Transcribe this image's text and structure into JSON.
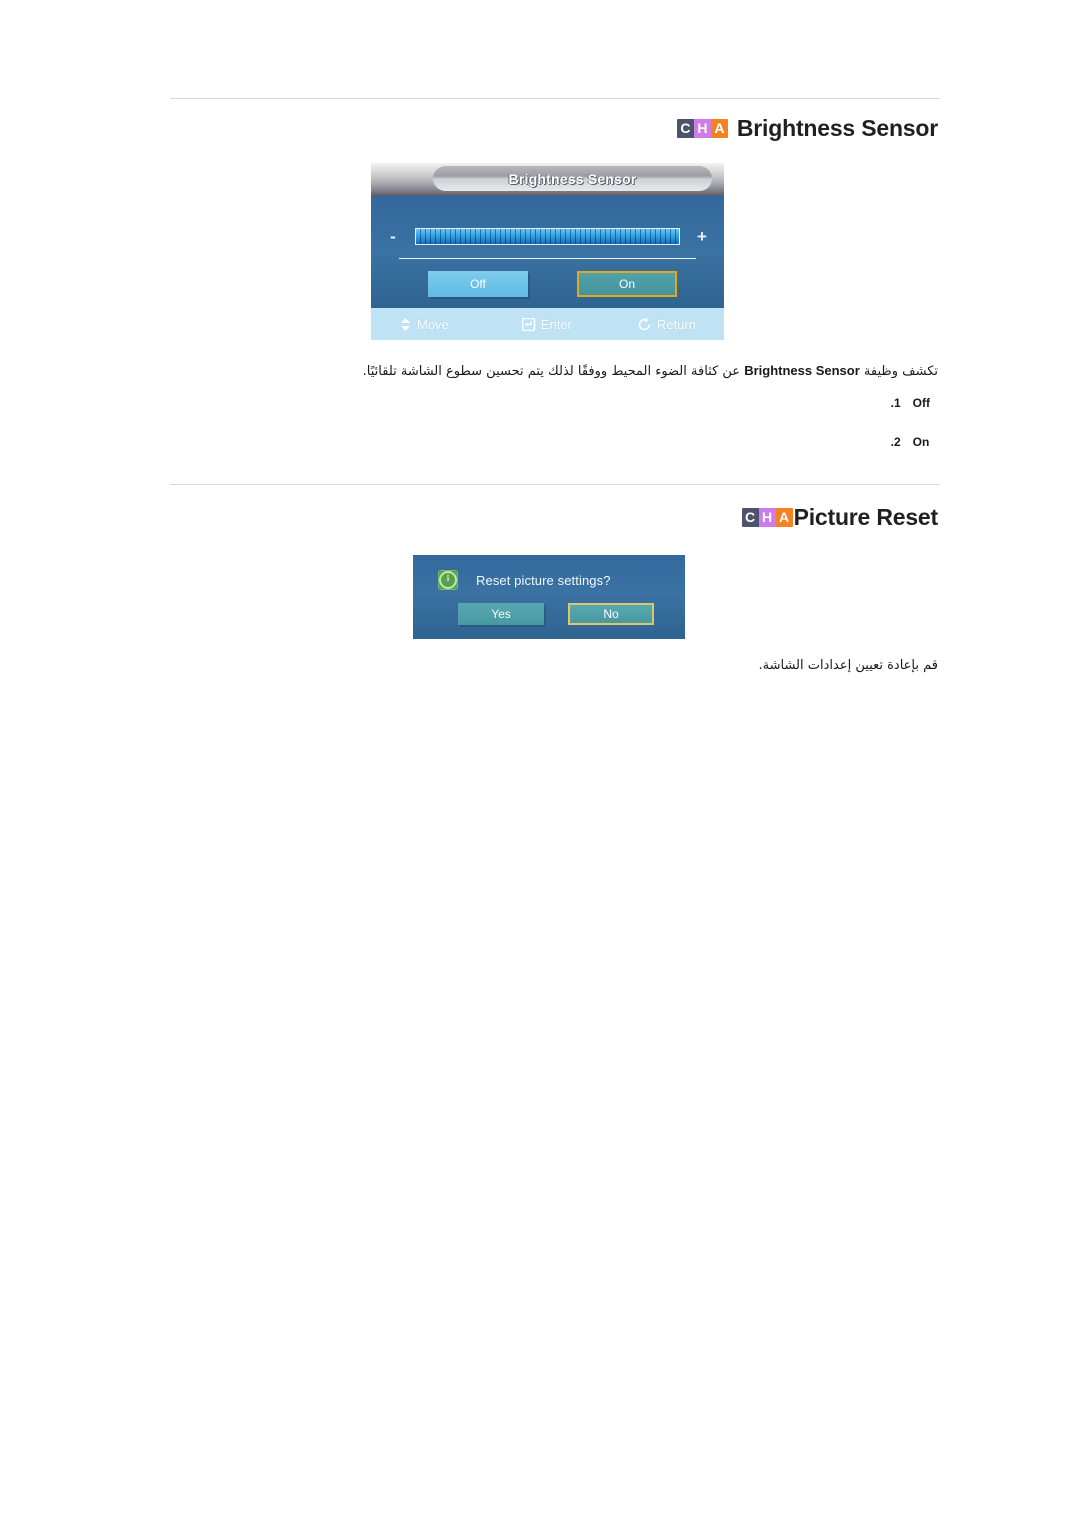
{
  "document": {
    "language": "ar",
    "direction": "rtl"
  },
  "sections": [
    {
      "id": "brightness-sensor",
      "logo": {
        "letters": [
          "C",
          "H",
          "A"
        ],
        "colors": [
          "#4c546b",
          "#d07ce8",
          "#f58220"
        ]
      },
      "title": "Brightness Sensor",
      "osd": {
        "titlebar": "Brightness Sensor",
        "minus": "-",
        "plus": "+",
        "buttons": [
          {
            "label": "Off",
            "selected": false
          },
          {
            "label": "On",
            "selected": true
          }
        ],
        "footer": [
          {
            "icon": "move-updown-icon",
            "label": "Move"
          },
          {
            "icon": "enter-key-icon",
            "label": "Enter"
          },
          {
            "icon": "return-arrow-icon",
            "label": "Return"
          }
        ]
      },
      "paragraph": {
        "before": "تكشف وظيفة ",
        "latin": "Brightness Sensor",
        "after": " عن كثافة الضوء المحيط ووفقًا لذلك يتم تحسين سطوع الشاشة تلقائيًا."
      },
      "options": [
        {
          "num": ".1",
          "label": "Off"
        },
        {
          "num": ".2",
          "label": "On"
        }
      ]
    },
    {
      "id": "picture-reset",
      "logo": {
        "letters": [
          "C",
          "H",
          "A"
        ],
        "colors": [
          "#4c546b",
          "#d07ce8",
          "#f58220"
        ]
      },
      "title": "Picture Reset",
      "dialog": {
        "icon": "info-icon",
        "icon_glyph": "i",
        "message": "Reset picture settings?",
        "buttons": [
          {
            "label": "Yes",
            "selected": false
          },
          {
            "label": "No",
            "selected": true
          }
        ]
      },
      "paragraph": {
        "text": "قم بإعادة تعيين إعدادات الشاشة."
      }
    }
  ]
}
